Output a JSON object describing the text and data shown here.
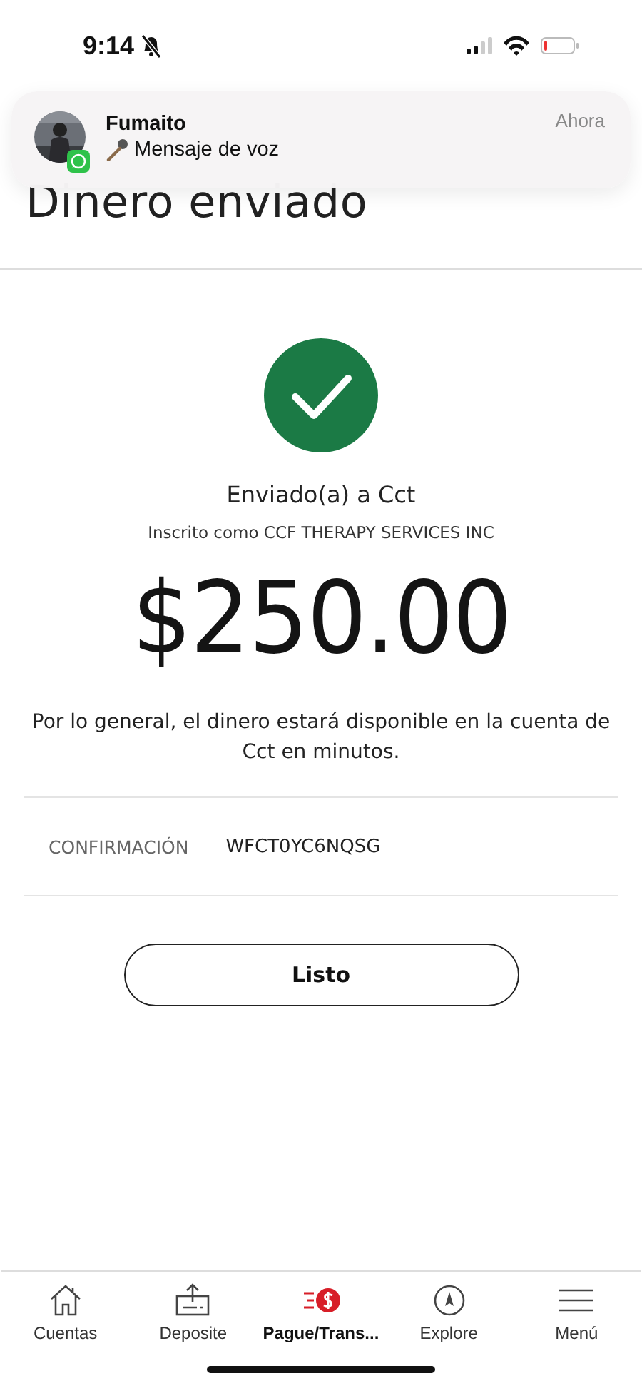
{
  "status_bar": {
    "time": "9:14",
    "silent": true
  },
  "notification": {
    "sender": "Fumaito",
    "message": "Mensaje de voz",
    "time": "Ahora"
  },
  "title": "Dinero enviado",
  "recipient": "Enviado(a) a Cct",
  "enrolled_as": "Inscrito como CCF THERAPY SERVICES INC",
  "amount": "$250.00",
  "note": "Por lo general, el dinero estará disponible en la cuenta de Cct en minutos.",
  "confirmation": {
    "label": "CONFIRMACIÓN",
    "value": "WFCT0YC6NQSG"
  },
  "done_button": "Listo",
  "tabs": [
    {
      "label": "Cuentas",
      "kind": "home",
      "selected": false
    },
    {
      "label": "Deposite",
      "kind": "deposit",
      "selected": false
    },
    {
      "label": "Pague/Trans...",
      "kind": "pay",
      "selected": true
    },
    {
      "label": "Explore",
      "kind": "compass",
      "selected": false
    },
    {
      "label": "Menú",
      "kind": "menu",
      "selected": false
    }
  ]
}
